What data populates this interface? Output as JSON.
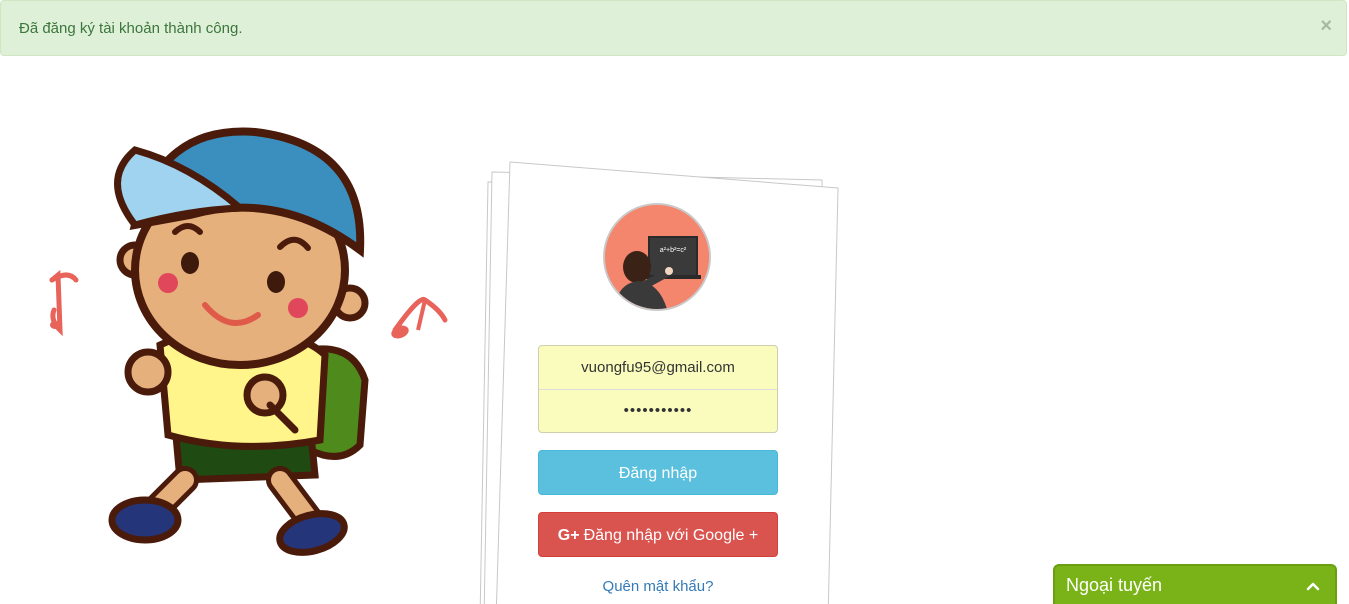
{
  "alert": {
    "message": "Đã đăng ký tài khoản thành công.",
    "close_label": "×"
  },
  "login": {
    "email_value": "vuongfu95@gmail.com",
    "password_value": "•••••••••••",
    "login_button": "Đăng nhập",
    "google_icon": "G+",
    "google_button": "Đăng nhập với Google +",
    "forgot_link": "Quên mật khẩu?",
    "avatar_board_text": "a²+b²=c²"
  },
  "chat": {
    "title": "Ngoại tuyến",
    "icon": "chevron-up-icon"
  },
  "colors": {
    "alert_bg": "#dff0d8",
    "alert_text": "#3c763d",
    "input_bg": "#f9fcbd",
    "login_btn": "#5bc0de",
    "google_btn": "#d9534f",
    "link": "#337ab7",
    "chat_bg": "#7ab317"
  }
}
